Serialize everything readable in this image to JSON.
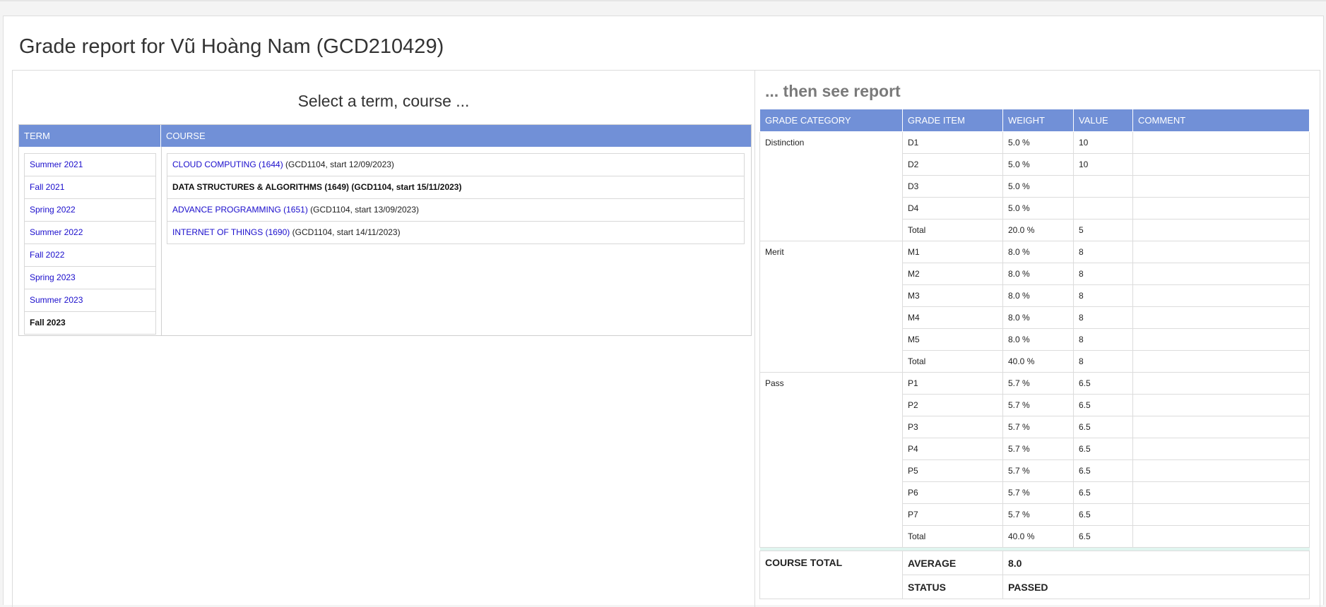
{
  "page_title": "Grade report for Vũ Hoàng Nam (GCD210429)",
  "select_title": "Select a term, course ...",
  "report_title": "... then see report",
  "selector": {
    "term_header": "TERM",
    "course_header": "COURSE",
    "terms": [
      {
        "label": "Summer 2021"
      },
      {
        "label": "Fall 2021"
      },
      {
        "label": "Spring 2022"
      },
      {
        "label": "Summer 2022"
      },
      {
        "label": "Fall 2022"
      },
      {
        "label": "Spring 2023"
      },
      {
        "label": "Summer 2023"
      },
      {
        "label": "Fall 2023"
      }
    ],
    "courses": [
      {
        "link": "CLOUD COMPUTING (1644)",
        "meta": "(GCD1104, start 12/09/2023)"
      },
      {
        "link": "DATA STRUCTURES & ALGORITHMS (1649)",
        "meta": "(GCD1104, start 15/11/2023)"
      },
      {
        "link": "ADVANCE PROGRAMMING (1651)",
        "meta": "(GCD1104, start 13/09/2023)"
      },
      {
        "link": "INTERNET OF THINGS (1690)",
        "meta": "(GCD1104, start 14/11/2023)"
      }
    ]
  },
  "report": {
    "headers": [
      "GRADE CATEGORY",
      "GRADE ITEM",
      "WEIGHT",
      "VALUE",
      "COMMENT"
    ],
    "groups": [
      {
        "category": "Distinction",
        "rows": [
          {
            "item": "D1",
            "weight": "5.0 %",
            "value": "10",
            "comment": ""
          },
          {
            "item": "D2",
            "weight": "5.0 %",
            "value": "10",
            "comment": ""
          },
          {
            "item": "D3",
            "weight": "5.0 %",
            "value": "",
            "comment": ""
          },
          {
            "item": "D4",
            "weight": "5.0 %",
            "value": "",
            "comment": ""
          },
          {
            "item": "Total",
            "weight": "20.0 %",
            "value": "5",
            "comment": ""
          }
        ]
      },
      {
        "category": "Merit",
        "rows": [
          {
            "item": "M1",
            "weight": "8.0 %",
            "value": "8",
            "comment": ""
          },
          {
            "item": "M2",
            "weight": "8.0 %",
            "value": "8",
            "comment": ""
          },
          {
            "item": "M3",
            "weight": "8.0 %",
            "value": "8",
            "comment": ""
          },
          {
            "item": "M4",
            "weight": "8.0 %",
            "value": "8",
            "comment": ""
          },
          {
            "item": "M5",
            "weight": "8.0 %",
            "value": "8",
            "comment": ""
          },
          {
            "item": "Total",
            "weight": "40.0 %",
            "value": "8",
            "comment": ""
          }
        ]
      },
      {
        "category": "Pass",
        "rows": [
          {
            "item": "P1",
            "weight": "5.7 %",
            "value": "6.5",
            "comment": ""
          },
          {
            "item": "P2",
            "weight": "5.7 %",
            "value": "6.5",
            "comment": ""
          },
          {
            "item": "P3",
            "weight": "5.7 %",
            "value": "6.5",
            "comment": ""
          },
          {
            "item": "P4",
            "weight": "5.7 %",
            "value": "6.5",
            "comment": ""
          },
          {
            "item": "P5",
            "weight": "5.7 %",
            "value": "6.5",
            "comment": ""
          },
          {
            "item": "P6",
            "weight": "5.7 %",
            "value": "6.5",
            "comment": ""
          },
          {
            "item": "P7",
            "weight": "5.7 %",
            "value": "6.5",
            "comment": ""
          },
          {
            "item": "Total",
            "weight": "40.0 %",
            "value": "6.5",
            "comment": ""
          }
        ]
      }
    ],
    "course_total": {
      "label": "COURSE TOTAL",
      "average_label": "AVERAGE",
      "average_value": "8.0",
      "status_label": "STATUS",
      "status_value": "PASSED",
      "status_color": "#118a11"
    }
  },
  "colors": {
    "header_bg": "#7190d7",
    "link": "#1a0dcc"
  }
}
